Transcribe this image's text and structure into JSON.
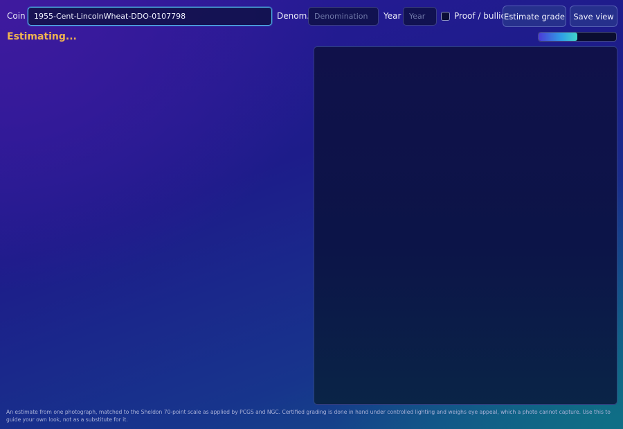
{
  "toolbar": {
    "coin_label": "Coin",
    "coin_value": "1955-Cent-LincolnWheat-DDO-0107798",
    "denom_label": "Denom.",
    "denom_placeholder": "Denomination",
    "denom_value": "",
    "year_label": "Year",
    "year_placeholder": "Year",
    "year_value": "",
    "proof_label": "Proof / bullion",
    "proof_checked": false,
    "estimate_button": "Estimate grade",
    "save_button": "Save view"
  },
  "status": {
    "text": "Estimating...",
    "progress": 0.5
  },
  "disclaimer": "An estimate from one photograph, matched to the Sheldon 70-point scale as applied by PCGS and NGC. Certified grading is done in hand under controlled lighting and weighs eye appeal, which a photo cannot capture. Use this to guide your own look, not as a substitute for it.",
  "colors": {
    "accent_status": "#f0b450",
    "focus_border": "#4fb4e8",
    "progress_start": "#4b3bd8",
    "progress_end": "#42d6c8"
  }
}
